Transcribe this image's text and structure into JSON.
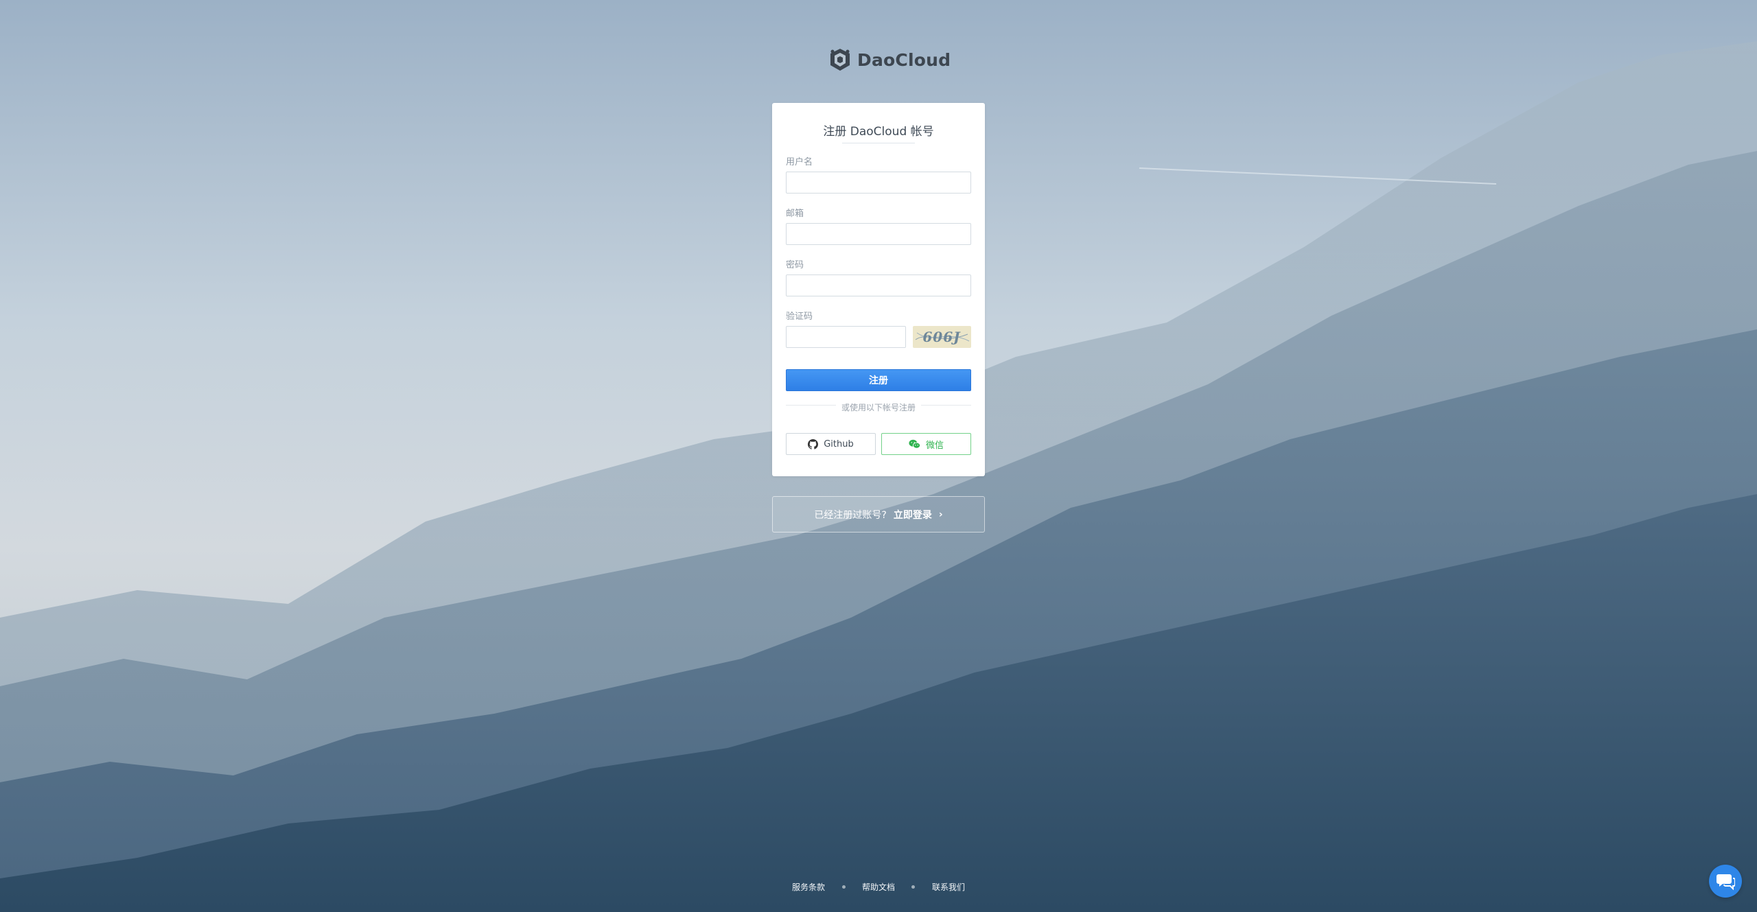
{
  "brand": {
    "name": "DaoCloud"
  },
  "form": {
    "title": "注册 DaoCloud 帐号",
    "username_label": "用户名",
    "username_value": "",
    "email_label": "邮箱",
    "email_value": "",
    "password_label": "密码",
    "password_value": "",
    "captcha_label": "验证码",
    "captcha_value": "",
    "captcha_text": "606J",
    "submit_label": "注册",
    "divider_text": "或使用以下帐号注册",
    "github_label": "Github",
    "wechat_label": "微信"
  },
  "login_prompt": {
    "text": "已经注册过账号?",
    "link": "立即登录"
  },
  "footer": {
    "links": [
      "服务条款",
      "帮助文档",
      "联系我们"
    ]
  },
  "icons": {
    "logo": "daocloud-logo-icon",
    "github": "github-icon",
    "wechat": "wechat-icon",
    "chevron": "chevron-right-icon",
    "chat": "chat-icon"
  },
  "colors": {
    "primary": "#2e7fe6",
    "wechat": "#2fb34f",
    "card_bg": "#ffffff",
    "chat": "#2e86e8"
  }
}
